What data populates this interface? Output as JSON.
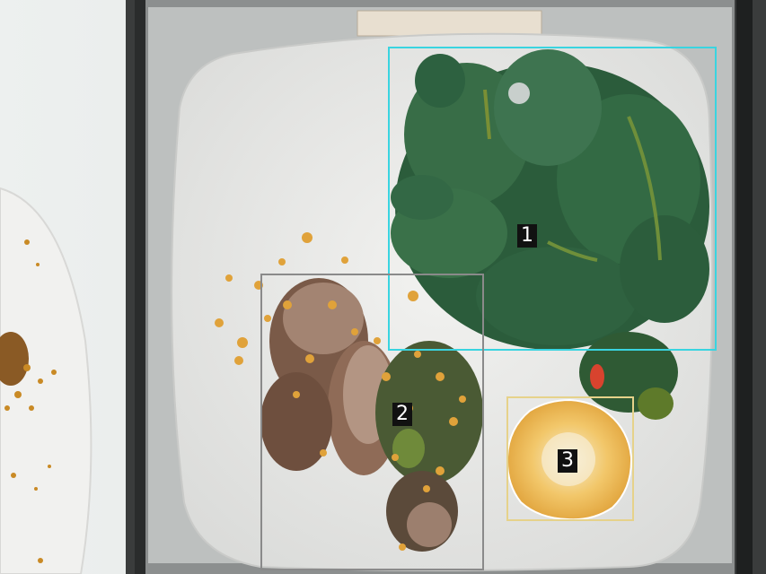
{
  "annotations": [
    {
      "label": "1",
      "color": "#39d4e0"
    },
    {
      "label": "2",
      "color": "#8a8a8a"
    },
    {
      "label": "3",
      "color": "#e6d28a"
    }
  ]
}
